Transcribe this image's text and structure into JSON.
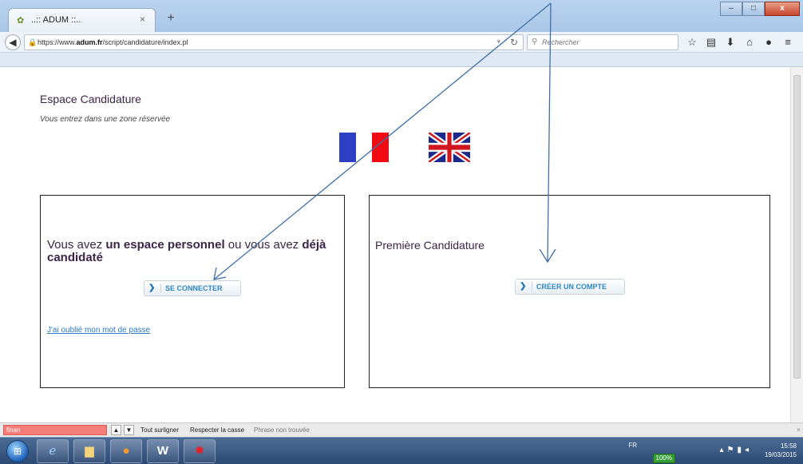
{
  "browser": {
    "tab_title": "..:: ADUM ::..",
    "tab_close": "×",
    "new_tab": "+",
    "url_prefix": "https://www.",
    "url_domain": "adum.fr",
    "url_path": "/script/candidature/index.pl",
    "search_placeholder": "Rechercher",
    "window_buttons": {
      "minimize": "–",
      "maximize": "□",
      "close": "x"
    }
  },
  "page": {
    "title": "Espace Candidature",
    "subtitle": "Vous entrez dans une zone réservée",
    "login_box": {
      "text_1": "Vous avez ",
      "text_bold_1": "un espace personnel",
      "text_2": " ou vous avez ",
      "text_bold_2": "déjà candidaté",
      "button_label": "SE CONNECTER",
      "forgot_link": "J'ai oublié mon mot de passe"
    },
    "first_box": {
      "title": "Première Candidature",
      "button_label": "CRÉER UN COMPTE"
    },
    "colors": {
      "heading": "#3c2448",
      "button_text": "#2d86c4",
      "annotation_arrow": "#3f6fa8"
    }
  },
  "findbar": {
    "input_value": "finan",
    "highlight_all": "Tout surligner",
    "match_case": "Respecter la casse",
    "status": "Phrase non trouvée",
    "close": "×"
  },
  "taskbar": {
    "lang": "FR",
    "battery": "100%",
    "time": "15:58",
    "date": "19/03/2015"
  }
}
